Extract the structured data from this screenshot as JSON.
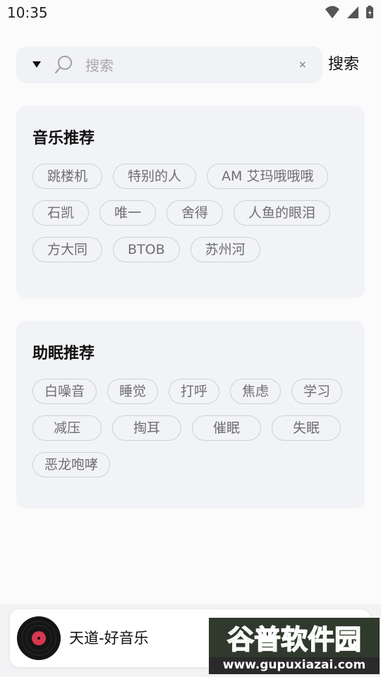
{
  "status_bar": {
    "time": "10:35"
  },
  "search": {
    "placeholder": "搜索",
    "clear_symbol": "×",
    "button_label": "搜索"
  },
  "music_section": {
    "title": "音乐推荐",
    "tags": [
      "跳楼机",
      "特别的人",
      "AM 艾玛哦哦哦",
      "石凯",
      "唯一",
      "舍得",
      "人鱼的眼泪",
      "方大同",
      "BTOB",
      "苏州河"
    ]
  },
  "sleep_section": {
    "title": "助眠推荐",
    "tags": [
      "白噪音",
      "睡觉",
      "打呼",
      "焦虑",
      "学习",
      "减压",
      "掏耳",
      "催眠",
      "失眠",
      "恶龙咆哮"
    ]
  },
  "player": {
    "track": "天道-好音乐",
    "accent": "#d7374f"
  },
  "watermark": {
    "title": "谷普软件园",
    "url": "www.gupuxiazai.com"
  }
}
